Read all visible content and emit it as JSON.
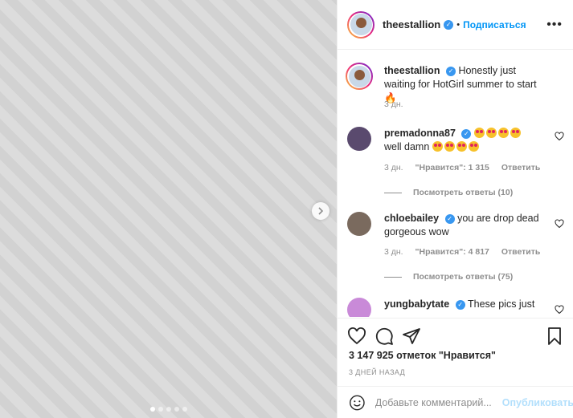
{
  "header": {
    "username": "theestallion",
    "separator": "•",
    "follow_label": "Подписаться",
    "more_icon": "more-icon"
  },
  "media": {
    "total_slides": 5,
    "active_slide": 1,
    "next_icon": "chevron-right-icon"
  },
  "caption": {
    "username": "theestallion",
    "text": "Honestly just waiting for HotGirl summer to start 🔥",
    "time": "3 дн."
  },
  "comments": [
    {
      "username": "premadonna87",
      "text": "well damn",
      "time": "3 дн.",
      "likes": "\"Нравится\": 1 315",
      "reply_label": "Ответить",
      "view_replies": "Посмотреть ответы (10)",
      "avatar_color": "#5a4a6e"
    },
    {
      "username": "chloebailey",
      "text": "you are drop dead gorgeous wow",
      "time": "3 дн.",
      "likes": "\"Нравится\": 4 817",
      "reply_label": "Ответить",
      "view_replies": "Посмотреть ответы (75)",
      "avatar_color": "#7a6a5e"
    },
    {
      "username": "yungbabytate",
      "text": "These pics just",
      "avatar_color": "#c98ad8"
    }
  ],
  "likes_text": "3 147 925 отметок \"Нравится\"",
  "post_date": "3 ДНЕЙ НАЗАД",
  "add_comment": {
    "placeholder": "Добавьте комментарий...",
    "publish_label": "Опубликовать"
  },
  "colors": {
    "accent": "#0095f6",
    "verified": "#3897f0",
    "muted": "#8e8e8e"
  }
}
